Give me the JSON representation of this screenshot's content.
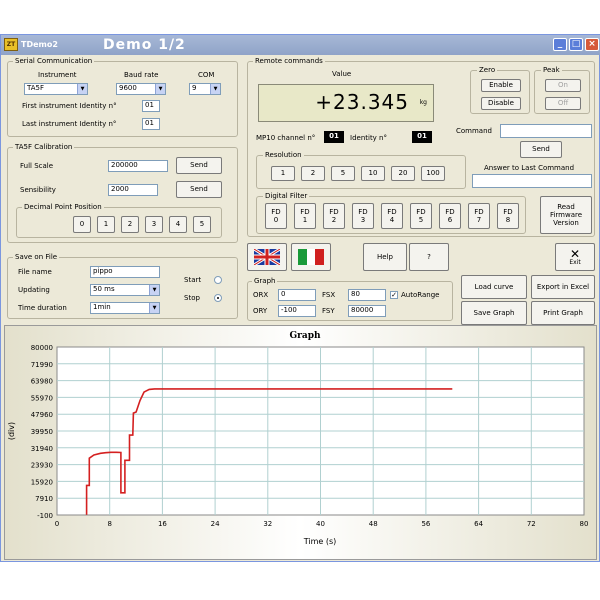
{
  "window": {
    "small_title": "TDemo2",
    "title": "Demo 1/2",
    "logo": "ZT",
    "min": "_",
    "max": "□",
    "close": "×"
  },
  "serial": {
    "group": "Serial Communication",
    "instrument_label": "Instrument",
    "baud_label": "Baud rate",
    "com_label": "COM",
    "instrument": "TA5F",
    "baud": "9600",
    "com": "9",
    "first_id_label": "First instrument Identity n°",
    "first_id": "01",
    "last_id_label": "Last instrument Identity n°",
    "last_id": "01"
  },
  "calibration": {
    "group": "TA5F Calibration",
    "full_scale_label": "Full Scale",
    "full_scale": "200000",
    "sensibility_label": "Sensibility",
    "sensibility": "2000",
    "send": "Send",
    "dp_group": "Decimal Point Position",
    "dp_buttons": [
      "0",
      "1",
      "2",
      "3",
      "4",
      "5"
    ]
  },
  "save": {
    "group": "Save on File",
    "file_name_label": "File name",
    "file_name": "pippo",
    "updating_label": "Updating",
    "updating": "50 ms",
    "duration_label": "Time duration",
    "duration": "1min",
    "start_label": "Start",
    "stop_label": "Stop"
  },
  "remote": {
    "group": "Remote commands",
    "value_label": "Value",
    "value": "+23.345",
    "unit": "kg",
    "mp10_label": "MP10 channel n°",
    "mp10": "01",
    "identity_label": "Identity n°",
    "identity": "01",
    "zero_group": "Zero",
    "peak_group": "Peak",
    "enable": "Enable",
    "disable": "Disable",
    "on": "On",
    "off": "Off",
    "command_label": "Command",
    "command_value": "",
    "send": "Send",
    "answer_label": "Answer to Last Command",
    "answer_value": "",
    "resolution_group": "Resolution",
    "resolution": [
      "1",
      "2",
      "5",
      "10",
      "20",
      "100"
    ],
    "filter_group": "Digital Filter",
    "filters": [
      "FD\n0",
      "FD\n1",
      "FD\n2",
      "FD\n3",
      "FD\n4",
      "FD\n5",
      "FD\n6",
      "FD\n7",
      "FD\n8"
    ],
    "firmware": "Read\nFirmware\nVersion"
  },
  "toolbar": {
    "help": "Help",
    "question": "?",
    "exit": "Exit",
    "load_curve": "Load curve",
    "export_excel": "Export in Excel",
    "save_graph": "Save Graph",
    "print_graph": "Print Graph"
  },
  "graph_settings": {
    "group": "Graph",
    "orx_label": "ORX",
    "orx": "0",
    "ory_label": "ORY",
    "ory": "-100",
    "fsx_label": "FSX",
    "fsx": "80",
    "fsy_label": "FSY",
    "fsy": "80000",
    "autorange_label": "AutoRange",
    "autorange_checked": "✓"
  },
  "colors": {
    "series": "#d42020",
    "plot_bg": "#ffffff",
    "grid": "#b0d0d0"
  },
  "chart_data": {
    "type": "line",
    "title": "Graph",
    "xlabel": "Time (s)",
    "ylabel": "(div)",
    "xlim": [
      0,
      80
    ],
    "ylim": [
      -100,
      80000
    ],
    "x_ticks": [
      0,
      8,
      16,
      24,
      32,
      40,
      48,
      56,
      64,
      72,
      80
    ],
    "y_ticks": [
      -100,
      7910,
      15920,
      23930,
      31940,
      39950,
      47960,
      55970,
      63980,
      71990,
      80000
    ],
    "grid": true,
    "series": [
      {
        "color": "#d42020",
        "x": [
          4.5,
          4.5,
          4.9,
          4.9,
          5.6,
          6.6,
          7.4,
          8.2,
          9.0,
          9.7,
          9.7,
          10.3,
          10.3,
          11.0,
          11.0,
          11.5,
          11.6,
          12.0,
          12.6,
          13.2,
          14.0,
          14.8,
          15.4,
          16.5,
          30.0,
          45.0,
          60.0
        ],
        "y": [
          0,
          14000,
          14000,
          27000,
          28500,
          29300,
          29600,
          29800,
          29800,
          29700,
          10500,
          10500,
          26000,
          26000,
          38000,
          38000,
          48500,
          49000,
          54500,
          58500,
          59800,
          60000,
          60000,
          60000,
          60000,
          60000,
          60000
        ]
      }
    ]
  }
}
